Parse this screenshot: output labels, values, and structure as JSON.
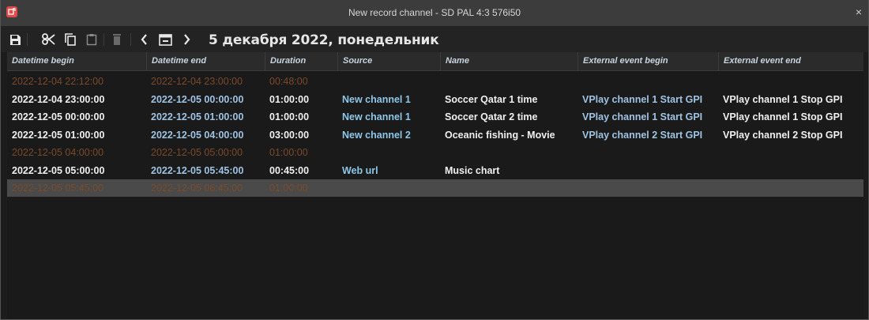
{
  "window": {
    "title": "New record channel - SD PAL 4:3 576i50",
    "close_label": "×"
  },
  "toolbar": {
    "date_label": "5 декабря 2022, понедельник"
  },
  "table": {
    "columns": [
      "Datetime begin",
      "Datetime end",
      "Duration",
      "Source",
      "Name",
      "External event begin",
      "External event end"
    ],
    "rows": [
      {
        "state": "dim",
        "begin": "2022-12-04 22:12:00",
        "end": "2022-12-04 23:00:00",
        "duration": "00:48:00",
        "source": "",
        "name": "",
        "ext_begin": "",
        "ext_end": ""
      },
      {
        "state": "active",
        "begin": "2022-12-04 23:00:00",
        "end": "2022-12-05 00:00:00",
        "duration": "01:00:00",
        "source": "New channel 1",
        "name": "Soccer Qatar 1 time",
        "ext_begin": "VPlay channel 1 Start GPI",
        "ext_end": "VPlay channel 1 Stop GPI"
      },
      {
        "state": "active",
        "begin": "2022-12-05 00:00:00",
        "end": "2022-12-05 01:00:00",
        "duration": "01:00:00",
        "source": "New channel 1",
        "name": "Soccer Qatar 2 time",
        "ext_begin": "VPlay channel 1 Start GPI",
        "ext_end": "VPlay channel 1 Stop GPI"
      },
      {
        "state": "active",
        "begin": "2022-12-05 01:00:00",
        "end": "2022-12-05 04:00:00",
        "duration": "03:00:00",
        "source": "New channel 2",
        "name": "Oceanic fishing - Movie",
        "ext_begin": "VPlay channel 2 Start GPI",
        "ext_end": "VPlay channel 2 Stop GPI"
      },
      {
        "state": "dim",
        "begin": "2022-12-05 04:00:00",
        "end": "2022-12-05 05:00:00",
        "duration": "01:00:00",
        "source": "",
        "name": "",
        "ext_begin": "",
        "ext_end": ""
      },
      {
        "state": "active",
        "begin": "2022-12-05 05:00:00",
        "end": "2022-12-05 05:45:00",
        "duration": "00:45:00",
        "source": "Web url",
        "name": "Music chart",
        "ext_begin": "",
        "ext_end": ""
      },
      {
        "state": "sel",
        "begin": "2022-12-05 05:45:00",
        "end": "2022-12-05 06:45:00",
        "duration": "01:00:00",
        "source": "",
        "name": "",
        "ext_begin": "",
        "ext_end": ""
      }
    ]
  },
  "colors": {
    "titlebar": "#3c3c3c",
    "app_icon": "#e14a4a",
    "dim_text": "#7a4a2a",
    "link_text": "#8ec6e8",
    "selected_row": "#4a4a4a"
  }
}
